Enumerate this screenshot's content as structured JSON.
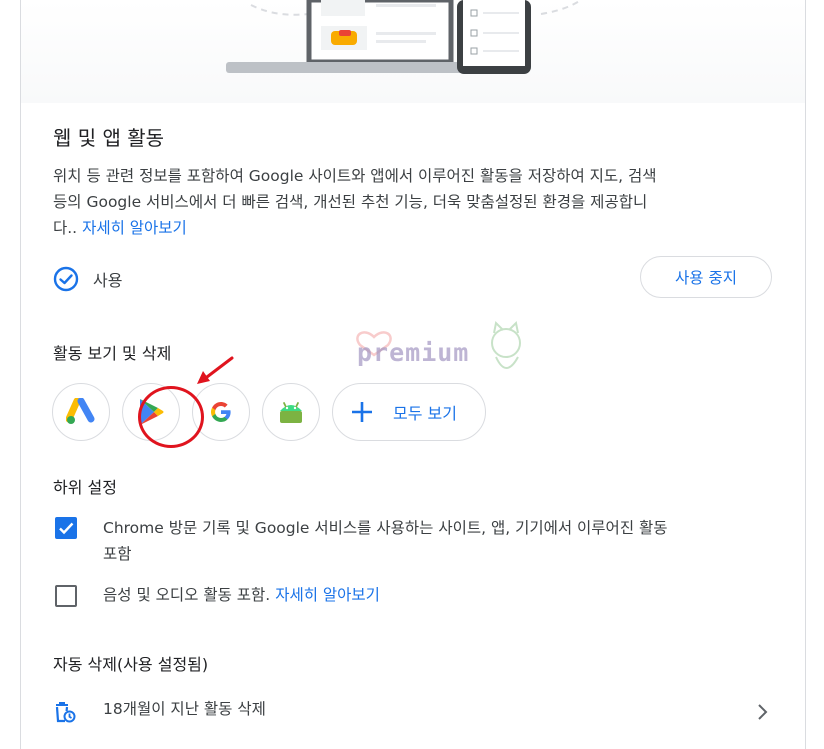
{
  "section": {
    "title": "웹 및 앱 활동",
    "description_line1": "위치 등 관련 정보를 포함하여 Google 사이트와 앱에서 이루어진 활동을 저장하여 지도, 검색",
    "description_line2": "등의 Google 서비스에서 더 빠른 검색, 개선된 추천 기능, 더욱 맞춤설정된 환경을 제공합니",
    "description_line3": "다..",
    "learn_more": "자세히 알아보기"
  },
  "status": {
    "icon": "check-circle-icon",
    "label": "사용",
    "pause_button": "사용 중지"
  },
  "activity": {
    "label": "활동 보기 및 삭제",
    "apps": [
      {
        "name": "google-ads",
        "icon": "google-ads-icon"
      },
      {
        "name": "google-play",
        "icon": "google-play-icon"
      },
      {
        "name": "google",
        "icon": "google-g-icon"
      },
      {
        "name": "android",
        "icon": "android-icon"
      }
    ],
    "see_all": "모두 보기"
  },
  "sub_settings": {
    "label": "하위 설정",
    "chrome_line1": "Chrome 방문 기록 및 Google 서비스를 사용하는 사이트, 앱, 기기에서 이루어진 활동",
    "chrome_line2": "포함",
    "chrome_checked": true,
    "audio_text": "음성 및 오디오 활동 포함.",
    "audio_learn_more": "자세히 알아보기",
    "audio_checked": false
  },
  "auto_delete": {
    "label": "자동 삭제(사용 설정됨)",
    "item": "18개월이 지난 활동 삭제",
    "icon": "auto-delete-icon"
  },
  "watermark": {
    "text": "premium"
  },
  "colors": {
    "accent": "#1a73e8",
    "annotation": "#e0141e"
  }
}
